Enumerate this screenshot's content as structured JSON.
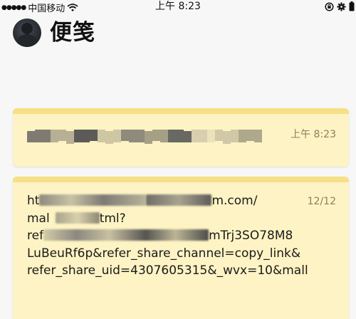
{
  "status_bar": {
    "carrier": "中国移动",
    "time": "上午 8:23"
  },
  "header": {
    "title": "便笺"
  },
  "notes": [
    {
      "time": "上午 8:23"
    },
    {
      "time": "12/12",
      "lines": [
        "ht",
        "m.com/",
        "mal",
        "tml?",
        "ref",
        "mTrj3SO78M8",
        "LuBeuRf6p&refer_share_channel=copy_link&",
        "refer_share_uid=4307605315&_wvx=10&mall"
      ]
    }
  ],
  "icons": {
    "signal": "signal-icon",
    "wifi": "wifi-icon",
    "rotation_lock": "rotation-lock-icon",
    "settings": "gear-icon",
    "battery": "battery-icon"
  },
  "colors": {
    "note_background": "#fdf3c4",
    "note_top_border": "#f7df86",
    "page_background": "#f7f7f7"
  }
}
